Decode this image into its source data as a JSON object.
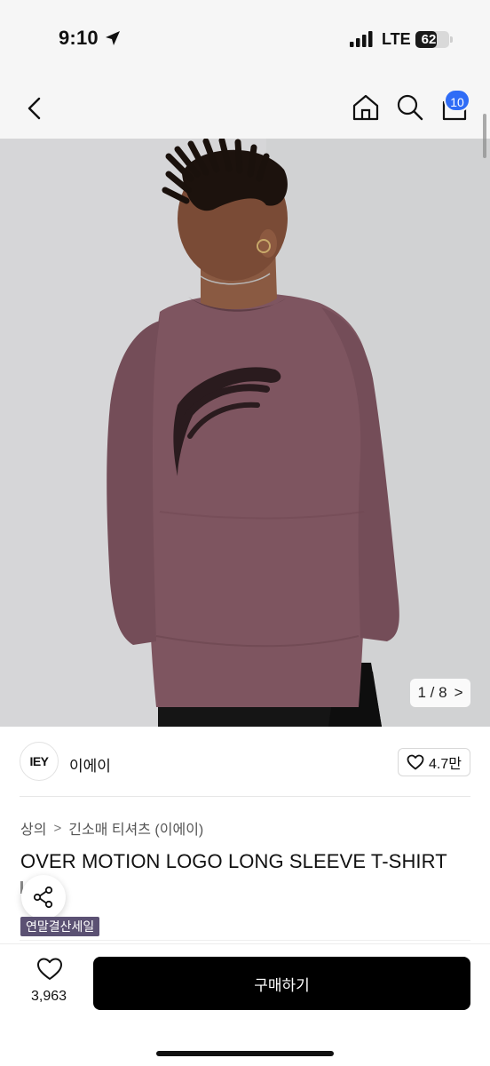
{
  "status_bar": {
    "time": "9:10",
    "network": "LTE",
    "battery_level": "62",
    "battery_fraction": 0.62
  },
  "nav": {
    "cart_count": "10"
  },
  "gallery": {
    "pager_text": "1 / 8",
    "pager_arrow": ">"
  },
  "brand": {
    "logo_text": "IEY",
    "name": "이에이",
    "likes": "4.7만"
  },
  "product": {
    "breadcrumb": [
      "상의",
      "긴소매 티셔츠 (이에이)"
    ],
    "breadcrumb_sep": ">",
    "title": "OVER MOTION LOGO LONG SLEEVE T-SHIRT",
    "badge": "연말결산세일"
  },
  "bottom": {
    "wish_count": "3,963",
    "buy_label": "구매하기"
  },
  "colors": {
    "accent_blue": "#2f6cf6",
    "badge_purple": "#5b5173",
    "buy_button": "#000000"
  },
  "icons": [
    "back-icon",
    "home-icon",
    "search-icon",
    "cart-icon",
    "heart-icon",
    "share-icon",
    "location-arrow-icon",
    "signal-icon",
    "battery-icon"
  ]
}
